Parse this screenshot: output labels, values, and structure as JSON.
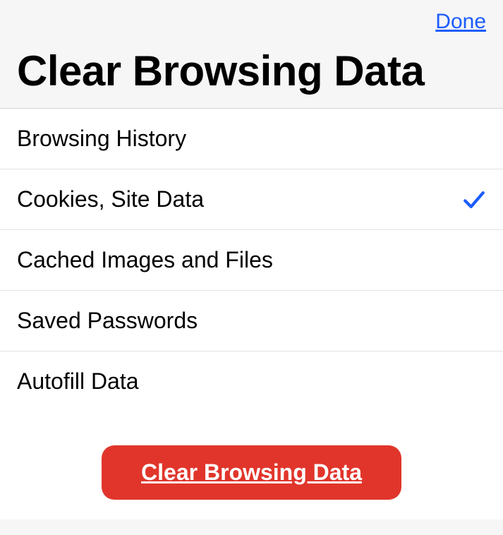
{
  "header": {
    "done_label": "Done",
    "title": "Clear Browsing Data"
  },
  "items": [
    {
      "label": "Browsing History",
      "checked": false
    },
    {
      "label": "Cookies, Site Data",
      "checked": true
    },
    {
      "label": "Cached Images and Files",
      "checked": false
    },
    {
      "label": "Saved Passwords",
      "checked": false
    },
    {
      "label": "Autofill Data",
      "checked": false
    }
  ],
  "action": {
    "clear_label": "Clear Browsing Data"
  },
  "colors": {
    "accent_blue": "#1b5cff",
    "destructive_red": "#e1352b"
  }
}
